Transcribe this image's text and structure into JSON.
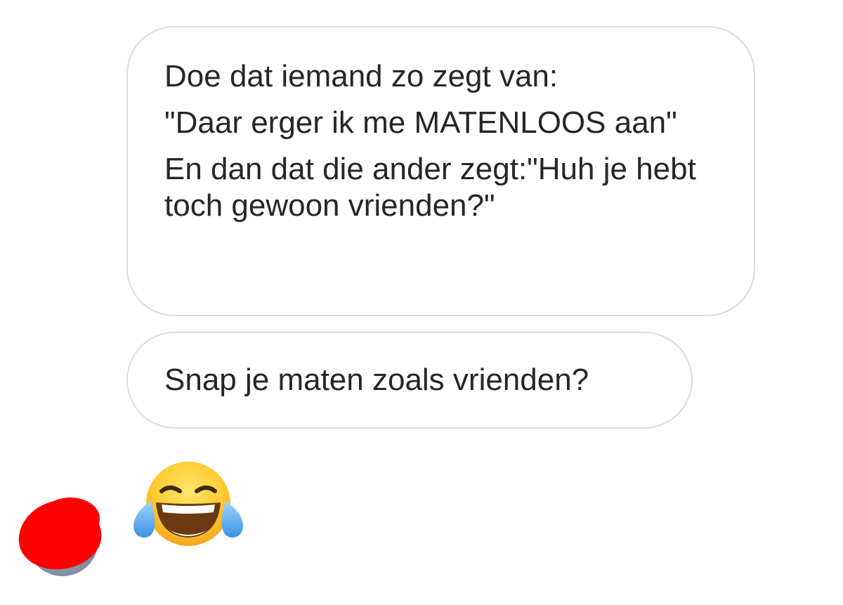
{
  "conversation": {
    "messages": [
      {
        "lines": [
          "Doe dat iemand zo zegt van:",
          "\"Daar erger ik me MATENLOOS aan\"",
          "En dan dat die ander zegt:\"Huh je hebt toch gewoon vrienden?\""
        ]
      },
      {
        "text": "Snap je maten zoals vrienden?"
      }
    ],
    "reply": {
      "emoji": "face-with-tears-of-joy-icon"
    }
  },
  "colors": {
    "bubble_border": "#dbdbdb",
    "text": "#262626",
    "redaction": "#ff0000"
  }
}
